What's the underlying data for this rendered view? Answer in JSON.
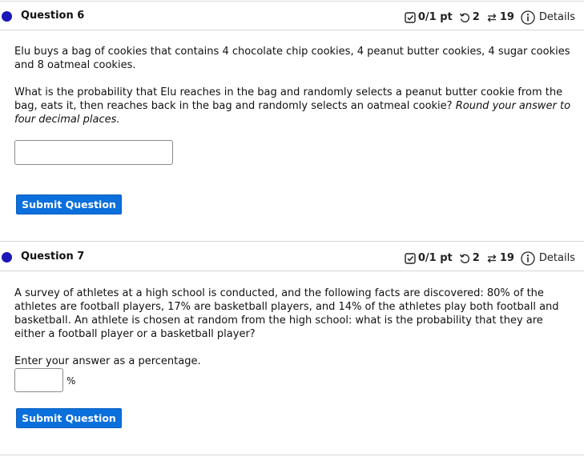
{
  "questions": [
    {
      "title": "Question 6",
      "points": "0/1 pt",
      "retries": "2",
      "submissions": "19",
      "details_label": "Details",
      "paragraph1": "Elu buys a bag of cookies that contains 4 chocolate chip cookies, 4 peanut butter cookies, 4 sugar cookies and 8 oatmeal cookies.",
      "paragraph2": "What is the probability that Elu reaches in the bag and randomly selects a peanut butter cookie from the bag, eats it, then reaches back in the bag and randomly selects an oatmeal cookie?",
      "paragraph2_italic": "Round your answer to four decimal places.",
      "answer_value": "",
      "submit_label": "Submit Question"
    },
    {
      "title": "Question 7",
      "points": "0/1 pt",
      "retries": "2",
      "submissions": "19",
      "details_label": "Details",
      "paragraph1": "A survey of athletes at a high school is conducted, and the following facts are discovered: 80% of the athletes are football players, 17% are basketball players, and 14% of the athletes play both football and basketball. An athlete is chosen at random from the high school: what is the probability that they are either a football player or a basketball player?",
      "instruction": "Enter your answer as a percentage.",
      "answer_value": "",
      "unit": "%",
      "submit_label": "Submit Question"
    }
  ],
  "colors": {
    "status_dot": "#1a16b8",
    "submit_bg": "#0b6fdc",
    "divider": "#d6d6d6"
  }
}
